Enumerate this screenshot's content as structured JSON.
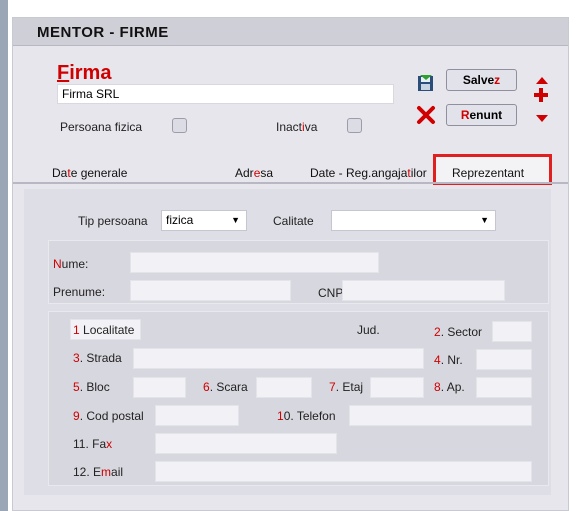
{
  "window": {
    "title": "MENTOR  -  FIRME"
  },
  "firma": {
    "label": "Firma",
    "value": "Firma SRL"
  },
  "flags": {
    "persoana_fizica": "Persoana fizica",
    "inactiva": "Inactiva"
  },
  "toolbar": {
    "save_label": "Salvez",
    "cancel_label": "Renunt"
  },
  "tabs": [
    {
      "label": "Date generale"
    },
    {
      "label": "Adresa"
    },
    {
      "label": "Date - Reg.angajatilor"
    },
    {
      "label": "Reprezentant"
    }
  ],
  "rep": {
    "tip_persoana_label": "Tip persoana",
    "tip_persoana_value": "fizica",
    "calitate_label": "Calitate",
    "calitate_value": "",
    "nume_label": "Nume:",
    "prenume_label": "Prenume:",
    "cnp_label": "CNP:"
  },
  "address": {
    "localitate": "1 Localitate",
    "jud": "Jud.",
    "sector": "2. Sector",
    "strada": "3. Strada",
    "nr": "4. Nr.",
    "bloc": "5. Bloc",
    "scara": "6. Scara",
    "etaj": "7. Etaj",
    "ap": "8. Ap.",
    "cod_postal": "9. Cod postal",
    "telefon": "10. Telefon",
    "fax": "11. Fax",
    "email": "12. Email"
  },
  "colors": {
    "accent_red": "#d00000",
    "highlight_border": "#e02020"
  }
}
